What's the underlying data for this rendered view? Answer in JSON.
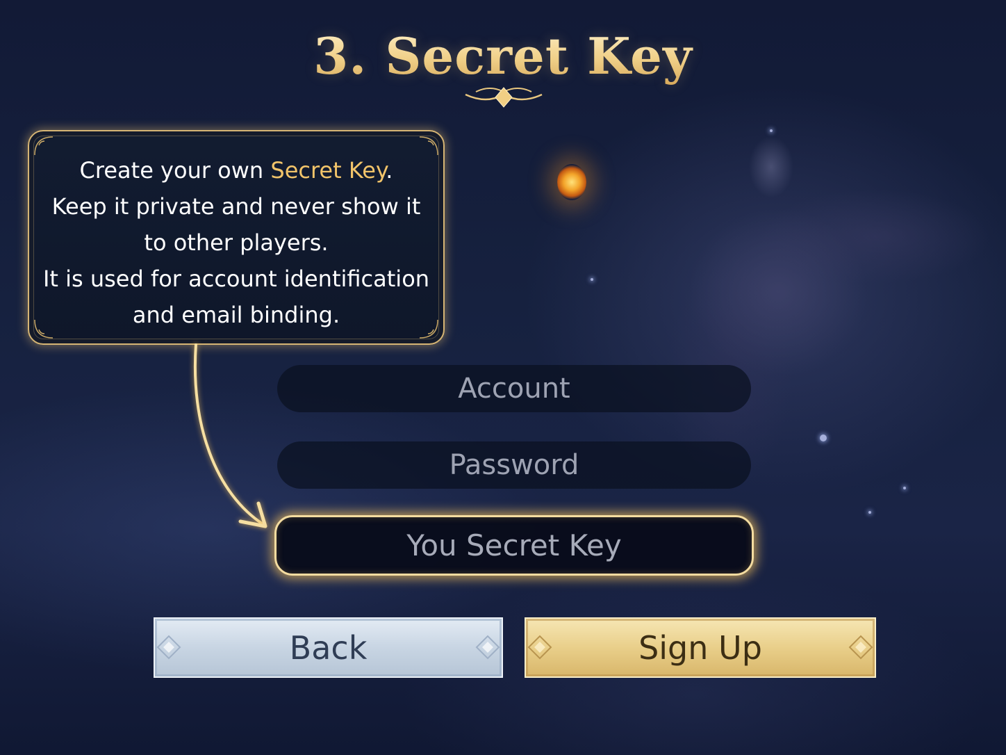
{
  "title": "3. Secret Key",
  "info": {
    "line1_prefix": "Create your own ",
    "line1_highlight": "Secret Key",
    "line1_suffix": ".",
    "line2": "Keep it private and never show it",
    "line3": "to other players.",
    "line4": "It is used for account identification",
    "line5": "and email binding."
  },
  "form": {
    "account_placeholder": "Account",
    "password_placeholder": "Password",
    "secret_key_placeholder": "You Secret Key"
  },
  "buttons": {
    "back_label": "Back",
    "signup_label": "Sign Up"
  },
  "colors": {
    "accent_gold": "#f2c46a",
    "highlight_border": "#f4dca0",
    "back_button": "#c8d5e3",
    "signup_button": "#e9cf8a"
  }
}
